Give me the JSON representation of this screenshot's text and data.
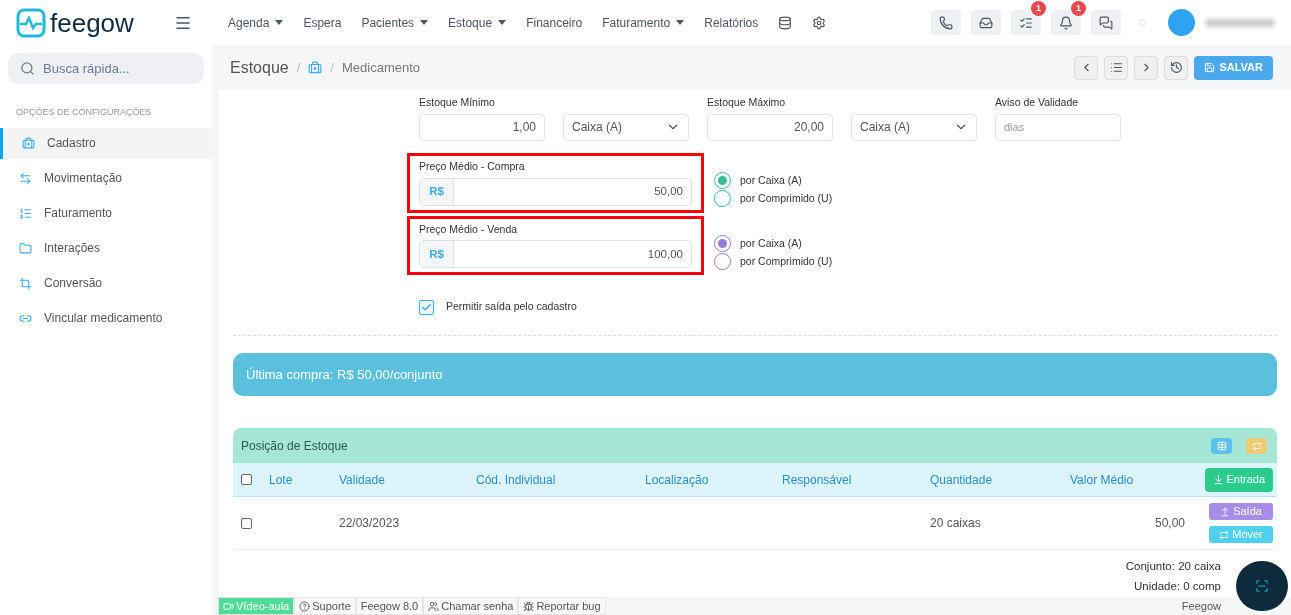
{
  "header": {
    "logo": "feegow",
    "nav": [
      {
        "label": "Agenda",
        "dropdown": true
      },
      {
        "label": "Espera",
        "dropdown": false
      },
      {
        "label": "Pacientes",
        "dropdown": true
      },
      {
        "label": "Estoque",
        "dropdown": true
      },
      {
        "label": "Financeiro",
        "dropdown": false
      },
      {
        "label": "Faturamento",
        "dropdown": true
      },
      {
        "label": "Relatórios",
        "dropdown": false
      }
    ],
    "actions": [
      {
        "kind": "phone"
      },
      {
        "kind": "inbox"
      },
      {
        "kind": "tasks",
        "badge": "1"
      },
      {
        "kind": "bell",
        "badge": "1"
      },
      {
        "kind": "chat"
      }
    ]
  },
  "search": {
    "placeholder": "Busca rápida..."
  },
  "breadcrumb": {
    "title": "Estoque",
    "separators": [
      "/",
      "/"
    ],
    "current": "Medicamento"
  },
  "save_button": "SALVAR",
  "sidebar": {
    "title": "OPÇÕES DE CONFIGURAÇÕES",
    "items": [
      {
        "label": "Cadastro",
        "selected": true
      },
      {
        "label": "Movimentação",
        "selected": false
      },
      {
        "label": "Faturamento",
        "selected": false
      },
      {
        "label": "Interações",
        "selected": false
      },
      {
        "label": "Conversão",
        "selected": false
      },
      {
        "label": "Vincular medicamento",
        "selected": false
      }
    ]
  },
  "stock": {
    "min_label": "Estoque Mínimo",
    "min_value": "1,00",
    "min_unit": "Caixa (A)",
    "max_label": "Estoque Máximo",
    "max_value": "20,00",
    "max_unit": "Caixa (A)",
    "expiry_label": "Aviso de Validade",
    "expiry_placeholder": "dias"
  },
  "prices": [
    {
      "label": "Preço Médio - Compra",
      "prefix": "R$",
      "value": "50,00",
      "color": "#37bc9b",
      "options": [
        {
          "label": "por Caixa (A)",
          "selected": true
        },
        {
          "label": "por Comprimido (U)",
          "selected": false
        }
      ]
    },
    {
      "label": "Preço Médio - Venda",
      "prefix": "R$",
      "value": "100,00",
      "color": "#967adc",
      "options": [
        {
          "label": "por Caixa (A)",
          "selected": true
        },
        {
          "label": "por Comprimido (U)",
          "selected": false
        }
      ]
    }
  ],
  "allow_exit": {
    "label": "Permitir saída pelo cadastro",
    "checked": true
  },
  "alert": "Última compra: R$ 50,00/conjunto",
  "position": {
    "title": "Posição de Estoque",
    "select_all_checked": false,
    "columns": [
      "Lote",
      "Validade",
      "Cód. Individual",
      "Localização",
      "Responsável",
      "Quantidade",
      "Valor Médio"
    ],
    "entry_button": "Entrada",
    "rows": [
      {
        "checked": false,
        "lote": "",
        "validade": "22/03/2023",
        "cod": "",
        "local": "",
        "resp": "",
        "quantidade": "20 caixas",
        "valor": "50,00",
        "actions": [
          {
            "kind": "exit",
            "label": "Saída"
          },
          {
            "kind": "move",
            "label": "Mover"
          }
        ]
      }
    ],
    "totals": [
      "Conjunto: 20 caixa",
      "Unidade: 0 comp"
    ]
  },
  "footer": {
    "items": [
      {
        "kind": "video",
        "label": "Vídeo-aula"
      },
      {
        "kind": "help",
        "label": "Suporte"
      },
      {
        "kind": "plain",
        "label": "Feegow 8.0"
      },
      {
        "kind": "people",
        "label": "Chamar senha"
      },
      {
        "kind": "bug",
        "label": "Reportar bug"
      }
    ],
    "right": "Feegow"
  }
}
